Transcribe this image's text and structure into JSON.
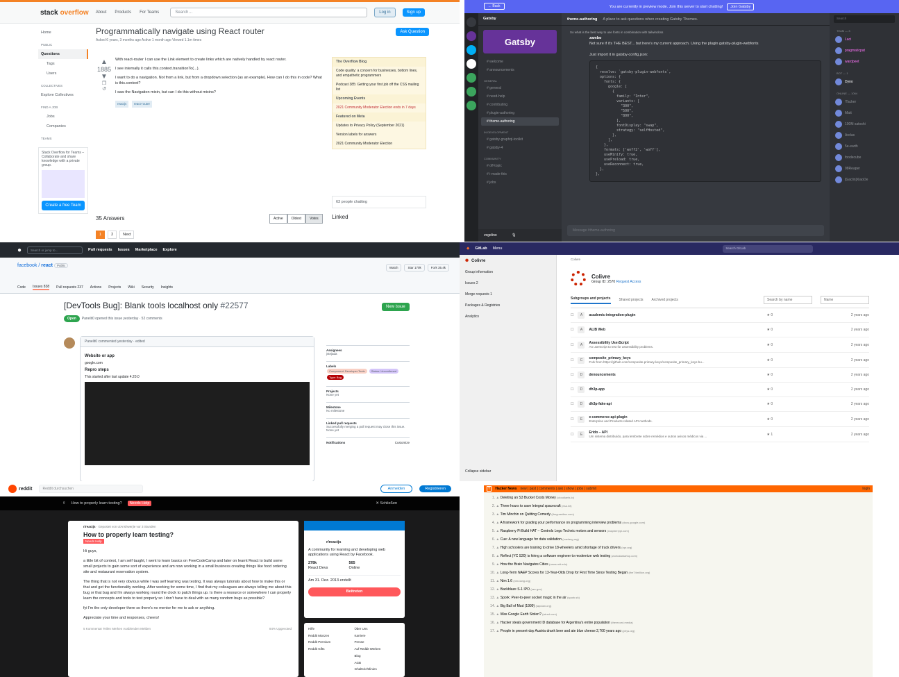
{
  "so": {
    "logo_a": "stack",
    "logo_b": "overflow",
    "nav": [
      "About",
      "Products",
      "For Teams"
    ],
    "search_placeholder": "Search…",
    "login": "Log in",
    "signup": "Sign up",
    "left": [
      "Home",
      "PUBLIC",
      "Questions",
      "Tags",
      "Users",
      "COLLECTIVES",
      "Explore Collectives",
      "FIND A JOB",
      "Jobs",
      "Companies",
      "TEAMS"
    ],
    "teams_text": "Stack Overflow for Teams – Collaborate and share knowledge with a private group.",
    "teams_btn": "Create a free Team",
    "title": "Programmatically navigate using React router",
    "meta": "Asked 6 years, 3 months ago   Active 1 month ago   Viewed 1.1m times",
    "ask": "Ask Question",
    "votes": "1885",
    "body1": "With react-router I can use the Link element to create links which are natively handled by react router.",
    "body2": "I see internally it calls this.context.transitionTo(...).",
    "body3": "I want to do a navigation. Not from a link, but from a dropdown selection (as an example). How can I do this in code? What is this.context?",
    "body4": "I saw the Navigation mixin, but can I do this without mixins?",
    "tags": [
      "reactjs",
      "react-router"
    ],
    "blog_h": "The Overflow Blog",
    "blog": [
      "Code quality: a concern for businesses, bottom lines, and empathetic programmers",
      "Podcast 385: Getting your first job off the CSS mailing list"
    ],
    "events_h": "Upcoming Events",
    "events": [
      "2021 Community Moderator Election ends in 7 days"
    ],
    "meta_h": "Featured on Meta",
    "meta_items": [
      "Updates to Privacy Policy (September 2021)",
      "Version labels for answers",
      "2021 Community Moderator Election"
    ],
    "chat": "63 people chatting",
    "linked": "Linked",
    "answers": "35 Answers",
    "sort": [
      "Active",
      "Oldest",
      "Votes"
    ],
    "pages": [
      "1",
      "2",
      "Next"
    ]
  },
  "dc": {
    "back": "← Back",
    "banner": "You are currently in preview mode. Join this server to start chatting!",
    "join": "Join Gatsby",
    "server": "Gatsby",
    "logo": "Gatsby",
    "channels_top": [
      "welcome",
      "announcements"
    ],
    "cat_general": "GENERAL",
    "channels_general": [
      "general",
      "need-help",
      "contributing",
      "plugin-authoring",
      "theme-authoring"
    ],
    "cat_dev": "IN DEVELOPMENT",
    "channels_dev": [
      "gatsby-graphql-toolkit",
      "gatsby-4"
    ],
    "cat_comm": "COMMUNITY",
    "channels_comm": [
      "off-topic",
      "i-made-this",
      "jobs"
    ],
    "user": "vogelino",
    "chan_title": "theme-authoring",
    "chan_topic": "A place to ask questions when creating Gatsby Themes.",
    "msg_author": "zambo",
    "msg1": "So what is the best way to use fonts in combination with tailwindcss",
    "msg2": "Not sure if it's THE BEST... but here's my current approach. Using the plugin gatsby-plugin-webfonts",
    "msg3": "Just import it in gatsby-config.json:",
    "code": "{\n  resolve: `gatsby-plugin-webfonts`,\n  options: {\n    fonts: {\n      google: [\n        {\n          family: \"Inter\",\n          variants: [\n            \"300\",\n            \"500\",\n            \"800\",\n          ],\n          fontDisplay: \"swap\",\n          strategy: \"selfHosted\",\n        },\n      ],\n    },\n    formats: ['woff2', 'woff'],\n    useMinify: true,\n    usePreload: true,\n    useReconnect: true,\n  },\n},",
    "input": "Message #theme-authoring",
    "search": "Search",
    "team_h": "TEAM — 3",
    "team": [
      "Laci",
      "pragmaticpat",
      "wardpeet"
    ],
    "bot_h": "BOT — 1",
    "bot": "Dyno",
    "online_h": "ONLINE — 1064",
    "online": [
      "!Tacker",
      "Matt",
      "100M satoshi",
      "Arelas",
      "5e-earth",
      "foodecube",
      "98Reaper",
      "[Gaclin]XiaoDe"
    ]
  },
  "gh": {
    "search": "Search or jump to...",
    "nav": [
      "Pull requests",
      "Issues",
      "Marketplace",
      "Explore"
    ],
    "repo_owner": "facebook",
    "repo_name": "react",
    "badge": "Public",
    "acts": [
      "Watch",
      "Star 170k",
      "Fork 35.4k"
    ],
    "tabs": [
      "Code",
      "Issues 838",
      "Pull requests 237",
      "Actions",
      "Projects",
      "Wiki",
      "Security",
      "Insights"
    ],
    "title": "[DevTools Bug]: Blank tools localhost only",
    "num": "#22577",
    "new_issue": "New issue",
    "status": "Open",
    "opened": "Panelit0 opened this issue yesterday · 52 comments",
    "cmt_head": "Panelit0 commented yesterday · edited",
    "h_site": "Website or app",
    "site": "google.com",
    "h_repro": "Repro steps",
    "repro": "This started after last update 4.20.0",
    "side": [
      {
        "t": "Assignees",
        "v": "jstejada"
      },
      {
        "t": "Labels",
        "v": ""
      },
      {
        "t": "Projects",
        "v": "None yet"
      },
      {
        "t": "Milestone",
        "v": "No milestone"
      },
      {
        "t": "Linked pull requests",
        "v": "Successfully merging a pull request may close this issue. None yet"
      },
      {
        "t": "Notifications",
        "v": "Customize"
      }
    ],
    "labels": [
      {
        "name": "Component: Developer Tools",
        "color": "#f9d0c4"
      },
      {
        "name": "Status: Unconfirmed",
        "color": "#d4c5f9"
      },
      {
        "name": "Type: Bug",
        "color": "#b60205"
      }
    ]
  },
  "gl": {
    "brand": "GitLab",
    "menu": "Menu",
    "search": "Search GitLab",
    "group": "Colivre",
    "side": [
      "Group information",
      "Issues 2",
      "Merge requests 1",
      "Packages & Registries",
      "Analytics"
    ],
    "collapse": "Collapse sidebar",
    "bc": "Colivre",
    "group_id": "Group ID: 2570",
    "access": "Request Access",
    "tabs": [
      "Subgroups and projects",
      "Shared projects",
      "Archived projects"
    ],
    "search_name": "Search by name",
    "sort": "Name",
    "projects": [
      {
        "l": "A",
        "n": "academic-integration-plugin",
        "d": "",
        "s": "0",
        "a": "2 years ago"
      },
      {
        "l": "A",
        "n": "ALIB Web",
        "d": "",
        "s": "0",
        "a": "2 years ago"
      },
      {
        "l": "A",
        "n": "Assessibility UserScript",
        "d": "An userscript to test for assessibility problems.",
        "s": "0",
        "a": "2 years ago"
      },
      {
        "l": "C",
        "n": "composite_primary_keys",
        "d": "Fork from https://github.com/composite-primary-keys/composite_primary_keys bu...",
        "s": "0",
        "a": "2 years ago"
      },
      {
        "l": "D",
        "n": "denouncements",
        "d": "",
        "s": "0",
        "a": "2 years ago"
      },
      {
        "l": "D",
        "n": "dh3p-app",
        "d": "",
        "s": "0",
        "a": "2 years ago"
      },
      {
        "l": "D",
        "n": "dh3p-fake-api",
        "d": "",
        "s": "0",
        "a": "2 years ago"
      },
      {
        "l": "E",
        "n": "e-commerce-api-plugin",
        "d": "Enterprise and Products related API methods.",
        "s": "0",
        "a": "2 years ago"
      },
      {
        "l": "E",
        "n": "Erido – API",
        "d": "Um sistema distribuído, para lembrete sobre remédios e outros avisos médicos via ...",
        "s": "1",
        "a": "2 years ago"
      }
    ]
  },
  "rd": {
    "logo": "reddit",
    "search": "Reddit durchsuchen",
    "login": "Anmelden",
    "register": "Registrieren",
    "bar_title": "How to properly learn testing?",
    "flair": "Needs Help",
    "close": "✕ Schließen",
    "sub": "r/reactjs",
    "posted": "Gepostet von u/Anshwerjie vor 3 Stunden",
    "title": "How to properly learn testing?",
    "p1": "Hi guys,",
    "p2": "a little bit of context, I am self taught, I went to learn basics on FreeCodeCamp and later on learnt React to build some small projects to gain some sort of experience and am now working in a small business creating things like food ordering site and restaurant reservation system.",
    "p3": "The thing that is not very obvious while I was self learning was testing. It was always tutorials about how to make this or that and get the functionality working. After working for some time, I find that my colleagues are always telling me about this bug or that bug and I'm always working round the clock to patch things up. Is there a resource or somewhere I can properly learn the concepts and tools to test properly so I don't have to deal with as many random bugs as possible?",
    "p4": "fyi I'm the only developer there so there's no mentor for me to ask or anything.",
    "p5": "Appreciate your time and responses, cheers!",
    "actions": "5 Kommentar   Teilen   Merken   Ausblenden   Melden",
    "upvoted": "84% Upgevoted",
    "rs_desc": "A community for learning and developing web applications using React by Facebook.",
    "members": "278k",
    "members_l": "React Devs",
    "online": "565",
    "online_l": "Online",
    "created": "Am 31. Dez. 2013 erstellt",
    "join": "Beitreten",
    "links": [
      "Hilfe",
      "Über Uns",
      "Reddit Münzen",
      "Karriere",
      "Reddit Premium",
      "Presse",
      "Reddit Gifts",
      "Auf Reddit Werben",
      "",
      "Blog",
      "",
      "AGB",
      "",
      "Inhaltsrichtlinien"
    ]
  },
  "hn": {
    "brand": "Hacker News",
    "nav": "new | past | comments | ask | show | jobs | submit",
    "login": "login",
    "items": [
      {
        "r": "1.",
        "t": "Deleting an S3 Bucket Costs Money",
        "d": "(cloudiants.io)"
      },
      {
        "r": "2.",
        "t": "Three hours to save Integral spacecraft",
        "d": "(esa.int)"
      },
      {
        "r": "3.",
        "t": "Tim Minchin on Quitting Comedy",
        "d": "(theguardian.com)"
      },
      {
        "r": "4.",
        "t": "A framework for grading your performance on programming interview problems",
        "d": "(docs.google.com)"
      },
      {
        "r": "5.",
        "t": "Raspberry Pi Build HAT – Controls Lego Technic motors and sensors",
        "d": "(raspberrypi.com)"
      },
      {
        "r": "6.",
        "t": "Cue: A new language for data validation",
        "d": "(cuelang.org)"
      },
      {
        "r": "7.",
        "t": "High schoolers are training to drive 18-wheelers amid shortage of truck drivers",
        "d": "(npr.org)"
      },
      {
        "r": "8.",
        "t": "Reflect (YC S20) is hiring a software engineer to modernize web testing",
        "d": "(workatastartup.com)"
      },
      {
        "r": "9.",
        "t": "How the Brain Navigates Cities",
        "d": "(news.mit.edu)"
      },
      {
        "r": "10.",
        "t": "Long-Term NAEP Scores for 13-Year-Olds Drop for First Time Since Testing Began",
        "d": "(the74million.org)"
      },
      {
        "r": "11.",
        "t": "Nim 1.6",
        "d": "(nim-lang.org)"
      },
      {
        "r": "12.",
        "t": "Backblaze S-1 IPO",
        "d": "(sec.gov)"
      },
      {
        "r": "13.",
        "t": "Spork: Peer-to-peer socket magic in the air",
        "d": "(spork.sh)"
      },
      {
        "r": "14.",
        "t": "Big Ball of Mud (1999)",
        "d": "(laputan.org)"
      },
      {
        "r": "15.",
        "t": "Was Google Earth Stolen?",
        "d": "(wired.com)"
      },
      {
        "r": "16.",
        "t": "Hacker steals government ID database for Argentina's entire population",
        "d": "(therecord.media)"
      },
      {
        "r": "17.",
        "t": "People in present-day Austria drank beer and ate blue cheese 2,700 years ago",
        "d": "(phys.org)"
      }
    ]
  }
}
